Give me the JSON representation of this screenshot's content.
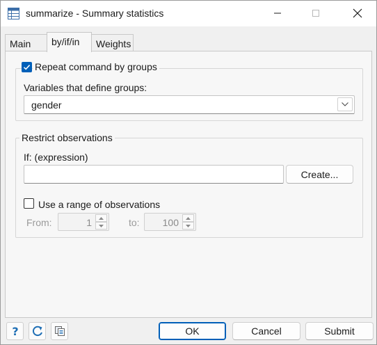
{
  "window": {
    "title": "summarize - Summary statistics"
  },
  "tabs": [
    {
      "label": "Main"
    },
    {
      "label": "by/if/in"
    },
    {
      "label": "Weights"
    }
  ],
  "by_group": {
    "checkbox_label": "Repeat command by groups",
    "checked": true,
    "variables_label": "Variables that define groups:",
    "variables_value": "gender"
  },
  "restrict": {
    "group_label": "Restrict observations",
    "if_label": "If: (expression)",
    "if_value": "",
    "create_label": "Create...",
    "range_checkbox_label": "Use a range of observations",
    "range_checked": false,
    "from_label": "From:",
    "from_value": "1",
    "to_label": "to:",
    "to_value": "100"
  },
  "footer": {
    "ok_label": "OK",
    "cancel_label": "Cancel",
    "submit_label": "Submit",
    "help_icon": "help-icon",
    "reset_icon": "reset-icon",
    "copy_icon": "copy-icon"
  },
  "colors": {
    "accent": "#005fb8",
    "help": "#1f6fb5"
  }
}
